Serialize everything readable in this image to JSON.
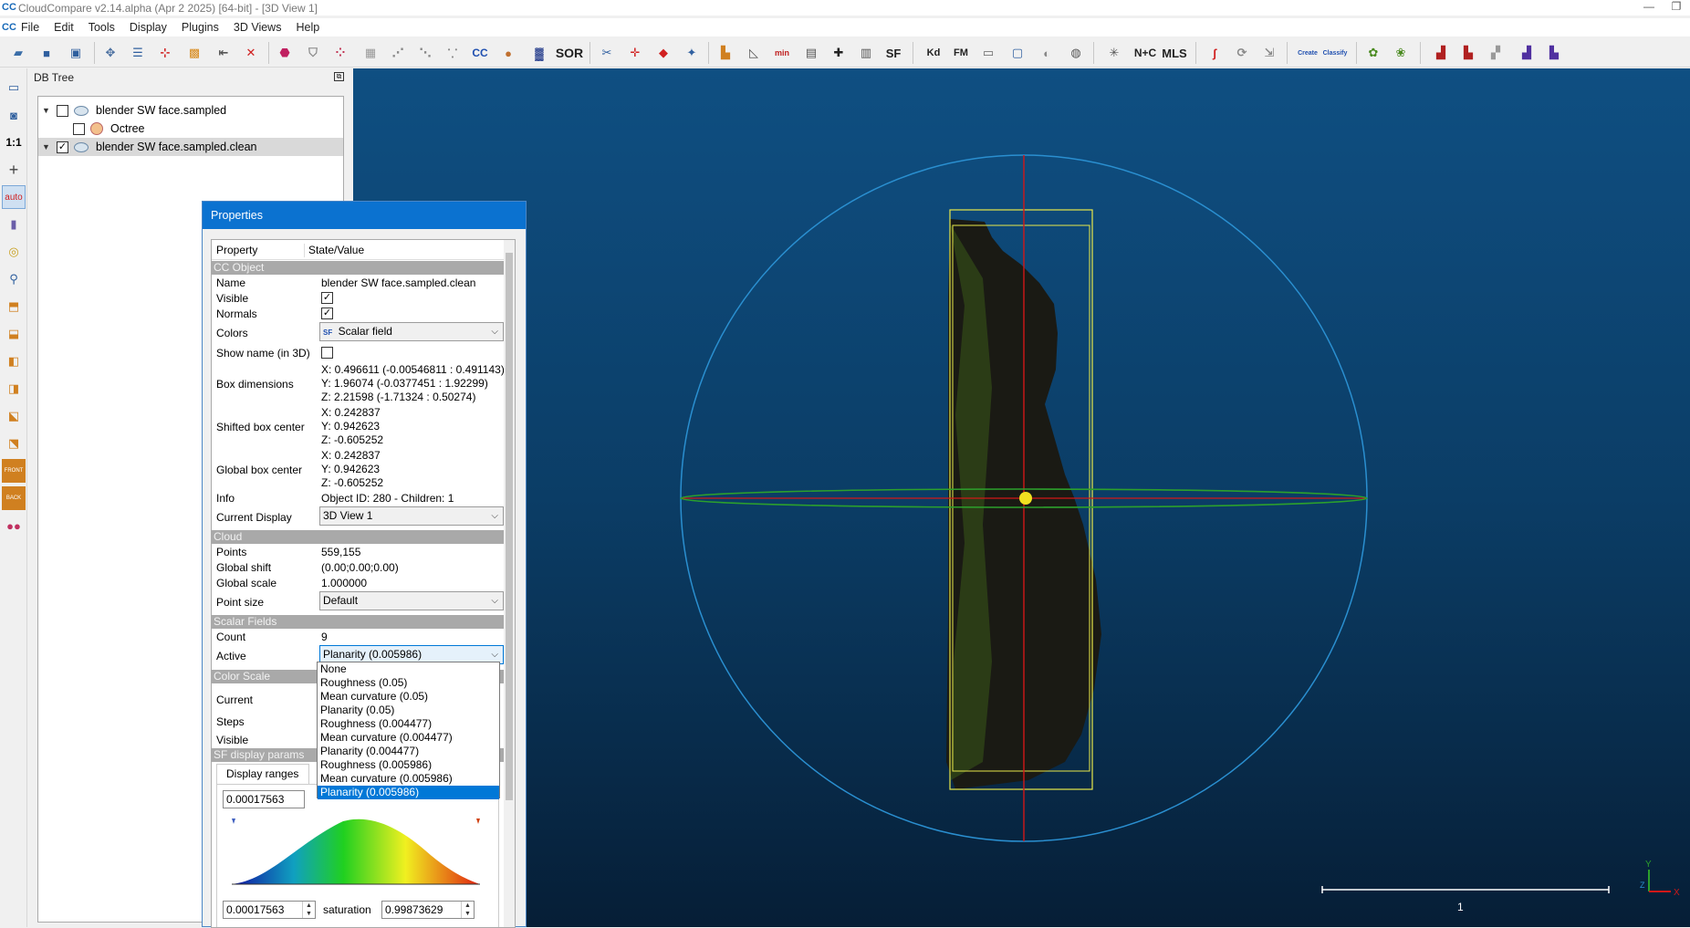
{
  "window": {
    "title": "CloudCompare v2.14.alpha (Apr  2 2025) [64-bit] - [3D View 1]",
    "minimize": "—",
    "restore": "❐"
  },
  "menu": [
    "File",
    "Edit",
    "Tools",
    "Display",
    "Plugins",
    "3D Views",
    "Help"
  ],
  "toolbar": {
    "sor_label": "SOR",
    "sf_label": "SF",
    "kd_label": "Kd",
    "fm_label": "FM",
    "nc_label": "N+C",
    "mls_label": "MLS",
    "canupo_create": "Create",
    "canupo_classify": "Classify",
    "cc_label": "CC"
  },
  "left_toolbar": {
    "ratio_label": "1:1",
    "front_label": "FRONT",
    "back_label": "BACK",
    "auto_label": "auto"
  },
  "db_tree": {
    "header": "DB Tree",
    "items": [
      {
        "label": "blender SW face.sampled",
        "checked": false
      },
      {
        "label": "Octree",
        "checked": false
      },
      {
        "label": "blender SW face.sampled.clean",
        "checked": true
      }
    ]
  },
  "properties": {
    "title": "Properties",
    "col_property": "Property",
    "col_value": "State/Value",
    "sections": {
      "cc_object": "CC Object",
      "cloud": "Cloud",
      "scalar_fields": "Scalar Fields",
      "color_scale": "Color Scale",
      "sf_display": "SF display params"
    },
    "name_key": "Name",
    "name_val": "blender SW face.sampled.clean",
    "visible_key": "Visible",
    "normals_key": "Normals",
    "colors_key": "Colors",
    "colors_val": "Scalar field",
    "colors_sf_badge": "SF",
    "showname_key": "Show name (in 3D)",
    "boxdim_key": "Box dimensions",
    "boxdim_x": "X: 0.496611 (-0.00546811 : 0.491143)",
    "boxdim_y": "Y: 1.96074 (-0.0377451 : 1.92299)",
    "boxdim_z": "Z: 2.21598 (-1.71324 : 0.50274)",
    "shifted_key": "Shifted box center",
    "shifted_x": "X: 0.242837",
    "shifted_y": "Y: 0.942623",
    "shifted_z": "Z: -0.605252",
    "global_key": "Global box center",
    "global_x": "X: 0.242837",
    "global_y": "Y: 0.942623",
    "global_z": "Z: -0.605252",
    "info_key": "Info",
    "info_val": "Object ID: 280 - Children: 1",
    "curdisp_key": "Current Display",
    "curdisp_val": "3D View 1",
    "points_key": "Points",
    "points_val": "559,155",
    "gshift_key": "Global shift",
    "gshift_val": "(0.00;0.00;0.00)",
    "gscale_key": "Global scale",
    "gscale_val": "1.000000",
    "psize_key": "Point size",
    "psize_val": "Default",
    "count_key": "Count",
    "count_val": "9",
    "active_key": "Active",
    "active_val": "Planarity (0.005986)",
    "current_key": "Current",
    "steps_key": "Steps",
    "visible2_key": "Visible",
    "display_ranges_tab": "Display ranges",
    "range_min": "0.00017563",
    "sat_min": "0.00017563",
    "saturation_label": "saturation",
    "sat_max": "0.99873629"
  },
  "active_dropdown": {
    "options": [
      "None",
      "Roughness (0.05)",
      "Mean curvature (0.05)",
      "Planarity (0.05)",
      "Roughness (0.004477)",
      "Mean curvature (0.004477)",
      "Planarity (0.004477)",
      "Roughness (0.005986)",
      "Mean curvature (0.005986)",
      "Planarity (0.005986)"
    ],
    "selected_index": 9
  },
  "view3d": {
    "scale_label": "1",
    "axis_y": "Y",
    "axis_x": "X",
    "axis_z": "Z"
  },
  "colors": {
    "accent": "#0078d7",
    "titlebar_blue": "#0b72d0",
    "bbox_yellow": "#e8e84a",
    "axis_red": "#d01818",
    "axis_green": "#2ca02c",
    "sphere_blue": "#2a8fd0"
  }
}
